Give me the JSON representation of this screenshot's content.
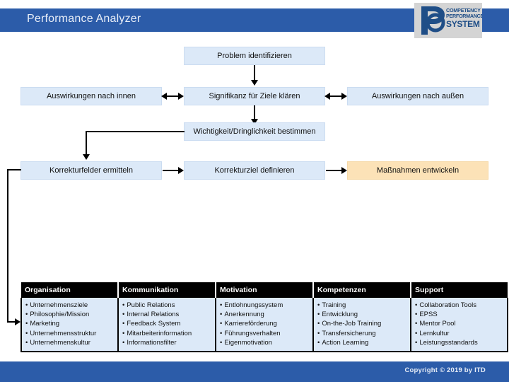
{
  "header": {
    "title": "Performance Analyzer",
    "logo": {
      "line1": "COMPETENCY",
      "line2": "PERFORMANCE",
      "line3": "SYSTEM",
      "mark_icon": "p-monogram-icon"
    },
    "bar_color": "#2C5CA9"
  },
  "flow": {
    "box_fill": "#DCE9F8",
    "accent_fill": "#FCE2B7",
    "nodes": [
      {
        "id": "problem",
        "label": "Problem identifizieren"
      },
      {
        "id": "innen",
        "label": "Auswirkungen nach innen"
      },
      {
        "id": "signifikanz",
        "label": "Signifikanz für Ziele klären"
      },
      {
        "id": "aussen",
        "label": "Auswirkungen nach außen"
      },
      {
        "id": "wichtigkeit",
        "label": "Wichtigkeit/Dringlichkeit bestimmen"
      },
      {
        "id": "korrekturfeld",
        "label": "Korrekturfelder ermitteln"
      },
      {
        "id": "korrekturziel",
        "label": "Korrekturziel definieren"
      },
      {
        "id": "massnahmen",
        "label": "Maßnahmen entwickeln"
      }
    ]
  },
  "matrix": {
    "columns": [
      "Organisation",
      "Kommunikation",
      "Motivation",
      "Kompetenzen",
      "Support"
    ],
    "bullet": "•",
    "rows": [
      [
        "Unternehmensziele",
        "Philosophie/Mission",
        "Marketing",
        "Unternehmensstruktur",
        "Unternehmenskultur"
      ],
      [
        "Public Relations",
        "Internal Relations",
        "Feedback System",
        "Mitarbeiterinformation",
        "Informationsfilter"
      ],
      [
        "Entlohnungssystem",
        "Anerkennung",
        "Karriereförderung",
        "Führungsverhalten",
        "Eigenmotivation"
      ],
      [
        "Training",
        "Entwicklung",
        "On-the-Job Training",
        "Transfersicherung",
        "Action Learning"
      ],
      [
        "Collaboration Tools",
        "EPSS",
        "Mentor Pool",
        "Lernkultur",
        "Leistungsstandards"
      ]
    ]
  },
  "footer": {
    "copyright": "Copyright © 2019 by ITD",
    "bar_color": "#2C5CA9"
  }
}
